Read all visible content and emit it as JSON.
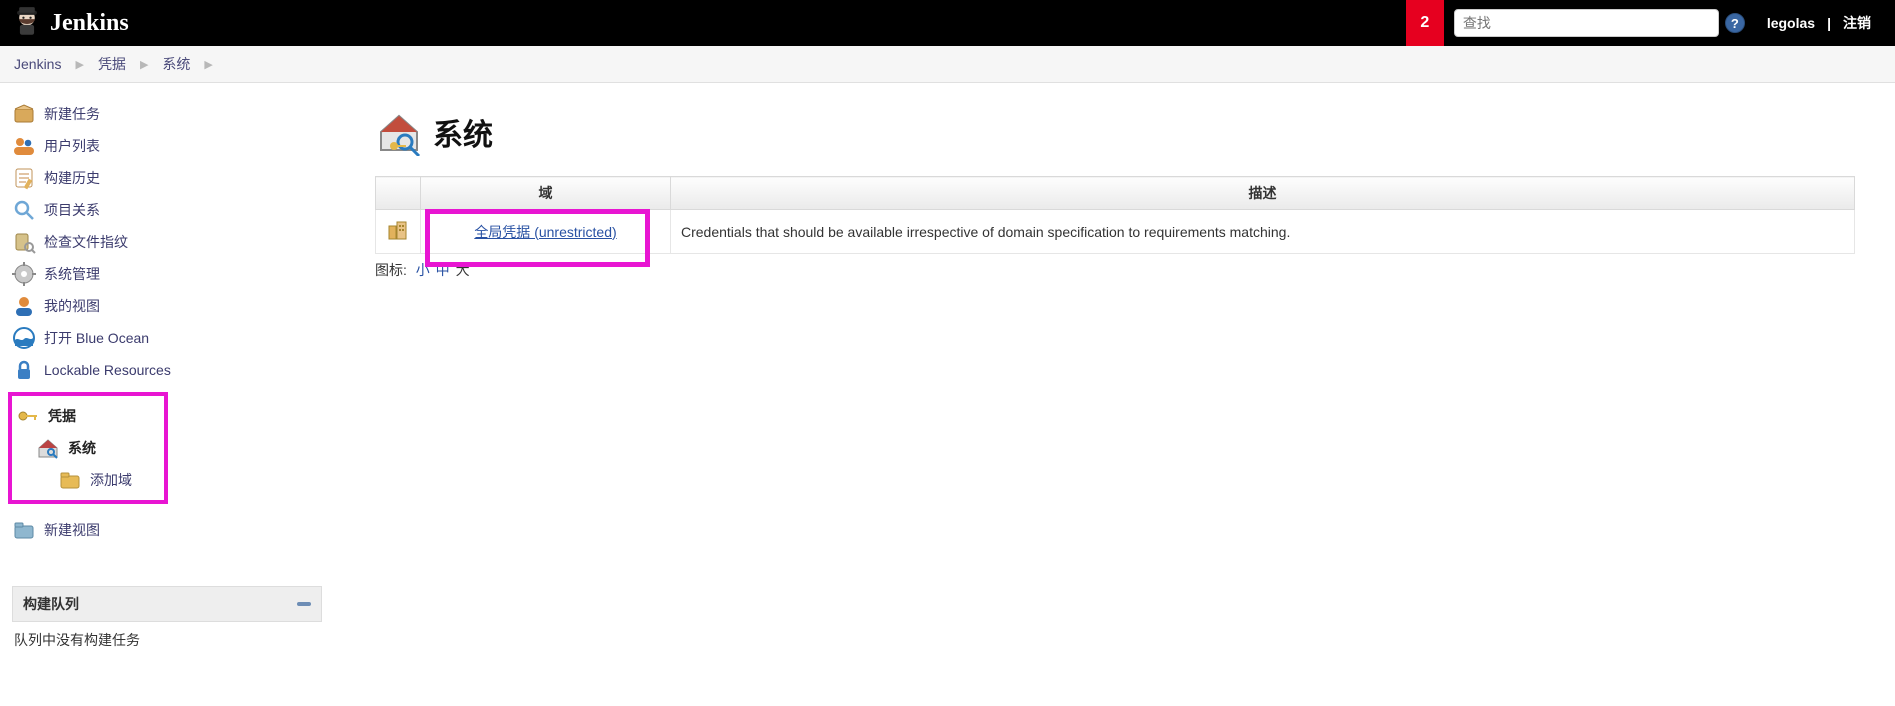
{
  "header": {
    "brand": "Jenkins",
    "notif_count": "2",
    "search_placeholder": "查找",
    "username": "legolas",
    "logout": "注销"
  },
  "breadcrumbs": [
    "Jenkins",
    "凭据",
    "系统"
  ],
  "sidebar": {
    "items": [
      {
        "label": "新建任务"
      },
      {
        "label": "用户列表"
      },
      {
        "label": "构建历史"
      },
      {
        "label": "项目关系"
      },
      {
        "label": "检查文件指纹"
      },
      {
        "label": "系统管理"
      },
      {
        "label": "我的视图"
      },
      {
        "label": "打开 Blue Ocean"
      },
      {
        "label": "Lockable Resources"
      }
    ],
    "cred_group": {
      "root": "凭据",
      "system": "系统",
      "add_domain": "添加域"
    },
    "new_view": "新建视图"
  },
  "build_queue": {
    "title": "构建队列",
    "empty": "队列中没有构建任务"
  },
  "main": {
    "title": "系统",
    "table": {
      "col_domain": "域",
      "col_desc": "描述",
      "rows": [
        {
          "name": "全局凭据 (unrestricted)",
          "desc": "Credentials that should be available irrespective of domain specification to requirements matching."
        }
      ]
    },
    "iconsize": {
      "label": "图标:",
      "small": "小",
      "medium": "中",
      "large": "大"
    }
  }
}
